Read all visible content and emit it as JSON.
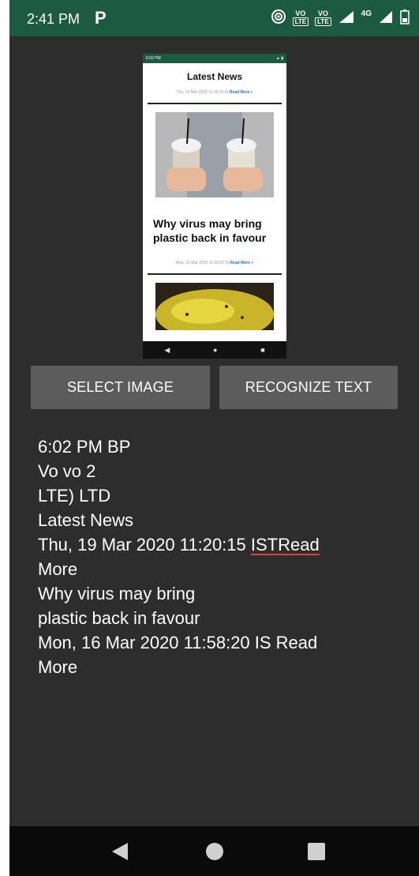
{
  "statusbar": {
    "time": "2:41 PM",
    "left_icon": "P",
    "volte1_top": "VO",
    "volte1_bottom": "LTE",
    "volte2_top": "VO",
    "volte2_bottom": "LTE",
    "network_label": "4G",
    "icons": [
      "hotspot-icon",
      "volte-icon",
      "signal-icon",
      "battery-icon"
    ]
  },
  "preview": {
    "status_time": "6:02 PM",
    "title": "Latest News",
    "meta1_date": "Thu, 19 Mar 2020 11:20:15 IS",
    "meta1_more": "Read More »",
    "headline": "Why virus may bring plastic back in favour",
    "meta2_date": "Mon, 16 Mar 2020 11:58:20 IS",
    "meta2_more": "Read More »"
  },
  "buttons": {
    "select_image": "SELECT IMAGE",
    "recognize_text": "RECOGNIZE TEXT"
  },
  "result": {
    "lines": [
      "6:02 PM BP",
      "Vo vo 2",
      "LTE) LTD",
      "Latest News",
      "Thu, 19 Mar 2020 11:20:15 ",
      "ISTRead",
      "More",
      "Why virus may bring",
      "plastic back in favour",
      "Mon, 16 Mar 2020 11:58:20 IS Read",
      "More"
    ]
  },
  "colors": {
    "statusbar": "#1c5a42",
    "background": "#2d2d2d",
    "button": "#5c5c5c",
    "navbar": "#0a0a0a",
    "spell_underline": "#e04040"
  }
}
